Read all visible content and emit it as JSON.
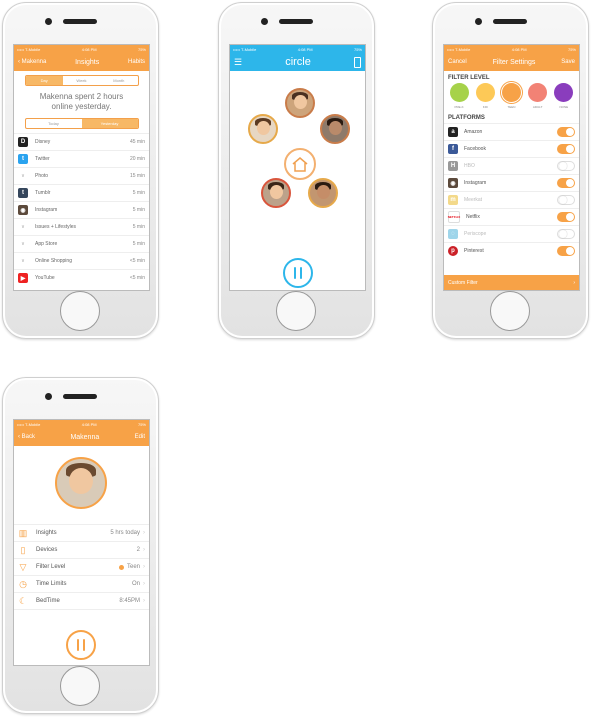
{
  "colors": {
    "orange": "#f7a247",
    "blue": "#2db6ea"
  },
  "insights": {
    "status": {
      "carrier": "••••• T-Mobile",
      "time": "4:08 PM",
      "battery": "75%"
    },
    "nav": {
      "back": "Makenna",
      "title": "Insights",
      "right": "Habits"
    },
    "range_tabs": [
      "Day",
      "Week",
      "Month"
    ],
    "selected_range": "Day",
    "summary": "Makenna spent 2 hours online yesterday.",
    "day_tabs": [
      "Today",
      "Yesterday"
    ],
    "selected_day": "Yesterday",
    "apps": [
      {
        "name": "Disney",
        "value": "45 min",
        "icon": "disney-icon"
      },
      {
        "name": "Twitter",
        "value": "20 min",
        "icon": "twitter-icon"
      },
      {
        "name": "Photo",
        "value": "15 min",
        "icon": "chevron-down-icon"
      },
      {
        "name": "Tumblr",
        "value": "5 min",
        "icon": "tumblr-icon"
      },
      {
        "name": "Instagram",
        "value": "5 min",
        "icon": "instagram-icon"
      },
      {
        "name": "Issues + Lifestyles",
        "value": "5 min",
        "icon": "chevron-down-icon"
      },
      {
        "name": "App Store",
        "value": "5 min",
        "icon": "chevron-down-icon"
      },
      {
        "name": "Online Shopping",
        "value": "<5 min",
        "icon": "chevron-down-icon"
      },
      {
        "name": "YouTube",
        "value": "<5 min",
        "icon": "youtube-icon"
      }
    ]
  },
  "home": {
    "status": {
      "carrier": "••••• T-Mobile",
      "time": "4:08 PM",
      "battery": "75%"
    },
    "nav": {
      "title": "circle"
    }
  },
  "filters": {
    "status": {
      "carrier": "••••• T-Mobile",
      "time": "4:08 PM",
      "battery": "75%"
    },
    "nav": {
      "left": "Cancel",
      "title": "Filter Settings",
      "right": "Save"
    },
    "filter_title": "FILTER LEVEL",
    "levels": [
      {
        "label": "PRE-K",
        "color": "#a6d24a"
      },
      {
        "label": "KID",
        "color": "#fdc957"
      },
      {
        "label": "TEEN",
        "color": "#f7a247"
      },
      {
        "label": "ADULT",
        "color": "#f28275"
      },
      {
        "label": "NONE",
        "color": "#8a3dbd"
      }
    ],
    "selected_level": "TEEN",
    "platforms_title": "PLATFORMS",
    "platforms": [
      {
        "name": "Amazon",
        "on": true,
        "icon": "amazon-icon"
      },
      {
        "name": "Facebook",
        "on": true,
        "icon": "facebook-icon"
      },
      {
        "name": "HBO",
        "on": false,
        "icon": "hbo-icon"
      },
      {
        "name": "Instagram",
        "on": true,
        "icon": "instagram-icon"
      },
      {
        "name": "Meerkat",
        "on": false,
        "icon": "meerkat-icon"
      },
      {
        "name": "Netflix",
        "on": true,
        "icon": "netflix-icon"
      },
      {
        "name": "Periscope",
        "on": false,
        "icon": "periscope-icon"
      },
      {
        "name": "Pinterest",
        "on": true,
        "icon": "pinterest-icon"
      }
    ],
    "custom_filter": "Custom Filter"
  },
  "profile": {
    "status": {
      "carrier": "••••• T-Mobile",
      "time": "4:08 PM",
      "battery": "75%"
    },
    "nav": {
      "left": "Back",
      "title": "Makenna",
      "right": "Edit"
    },
    "rows": [
      {
        "name": "Insights",
        "value": "5 hrs today",
        "icon": "insights-icon"
      },
      {
        "name": "Devices",
        "value": "2",
        "icon": "devices-icon"
      },
      {
        "name": "Filter Level",
        "value": "Teen",
        "icon": "filter-icon"
      },
      {
        "name": "Time Limits",
        "value": "On",
        "icon": "clock-icon"
      },
      {
        "name": "BedTime",
        "value": "8:45PM",
        "icon": "moon-icon"
      }
    ]
  }
}
